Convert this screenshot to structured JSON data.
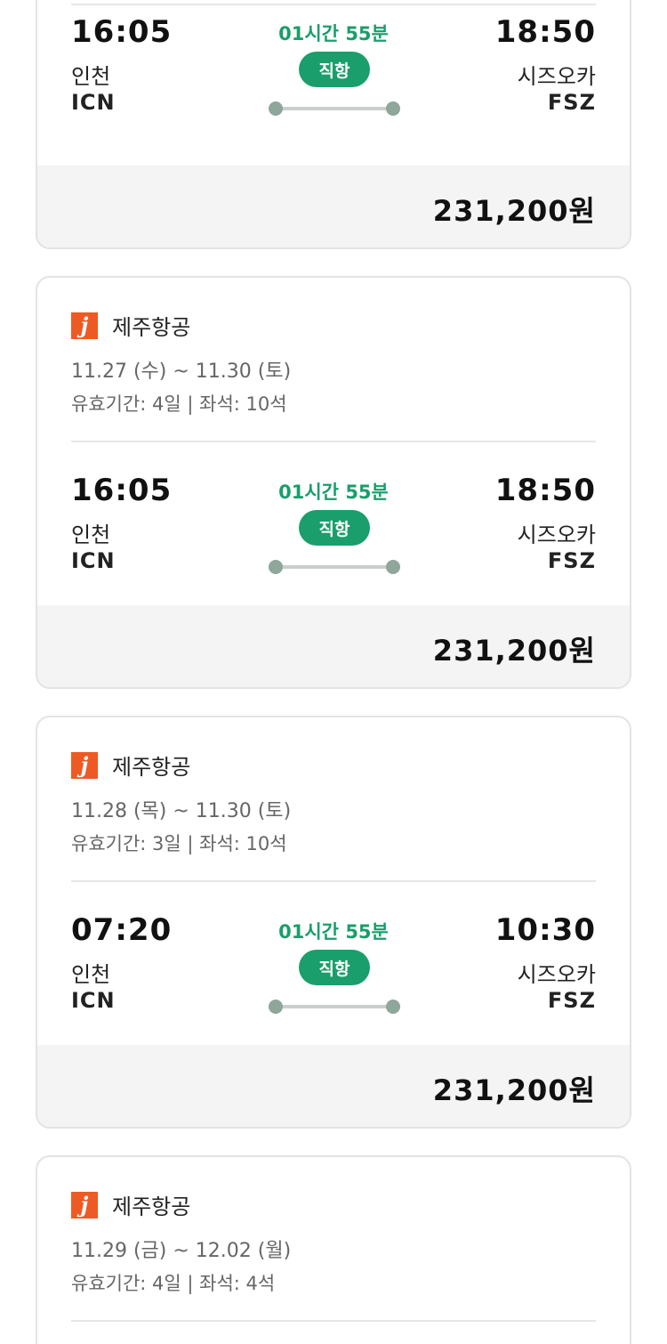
{
  "cards": [
    {
      "airline": "",
      "dates": "",
      "validity": "",
      "flight": {
        "dep_time": "16:05",
        "dep_city": "인천",
        "dep_code": "ICN",
        "duration": "01시간 55분",
        "badge": "직항",
        "arr_time": "18:50",
        "arr_city": "시즈오카",
        "arr_code": "FSZ"
      },
      "price": "231,200원"
    },
    {
      "airline": "제주항공",
      "logo_letter": "j",
      "dates": "11.27 (수) ~ 11.30 (토)",
      "validity": "유효기간: 4일 | 좌석: 10석",
      "flight": {
        "dep_time": "16:05",
        "dep_city": "인천",
        "dep_code": "ICN",
        "duration": "01시간 55분",
        "badge": "직항",
        "arr_time": "18:50",
        "arr_city": "시즈오카",
        "arr_code": "FSZ"
      },
      "price": "231,200원"
    },
    {
      "airline": "제주항공",
      "logo_letter": "j",
      "dates": "11.28 (목) ~ 11.30 (토)",
      "validity": "유효기간: 3일 | 좌석: 10석",
      "flight": {
        "dep_time": "07:20",
        "dep_city": "인천",
        "dep_code": "ICN",
        "duration": "01시간 55분",
        "badge": "직항",
        "arr_time": "10:30",
        "arr_city": "시즈오카",
        "arr_code": "FSZ"
      },
      "price": "231,200원"
    },
    {
      "airline": "제주항공",
      "logo_letter": "j",
      "dates": "11.29 (금) ~ 12.02 (월)",
      "validity": "유효기간: 4일 | 좌석: 4석"
    }
  ],
  "colors": {
    "accent": "#1a9e6b",
    "logo": "#ee5a24",
    "price_bg": "#f4f4f4"
  }
}
